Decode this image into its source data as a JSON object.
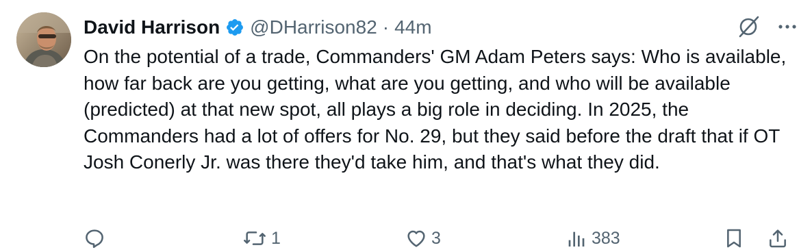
{
  "author": {
    "name": "David Harrison",
    "handle": "@DHarrison82",
    "separator": "·",
    "time": "44m",
    "verified_icon": "verified-badge-icon"
  },
  "header_icons": [
    "grok-icon",
    "more-icon"
  ],
  "tweet": {
    "text": "On the potential of a trade, Commanders' GM Adam Peters says: Who is available, how far back are you getting, what are you getting, and who will be available (predicted) at that new spot, all plays a big role in deciding. In 2025, the Commanders had a lot of offers for No. 29, but they said before the draft that if OT Josh Conerly Jr. was there they'd take him, and that's what they did."
  },
  "actions": {
    "replies": "",
    "reposts": "1",
    "likes": "3",
    "views": "383"
  },
  "colors": {
    "text": "#0f1419",
    "secondary": "#536471",
    "verified": "#1d9bf0"
  }
}
